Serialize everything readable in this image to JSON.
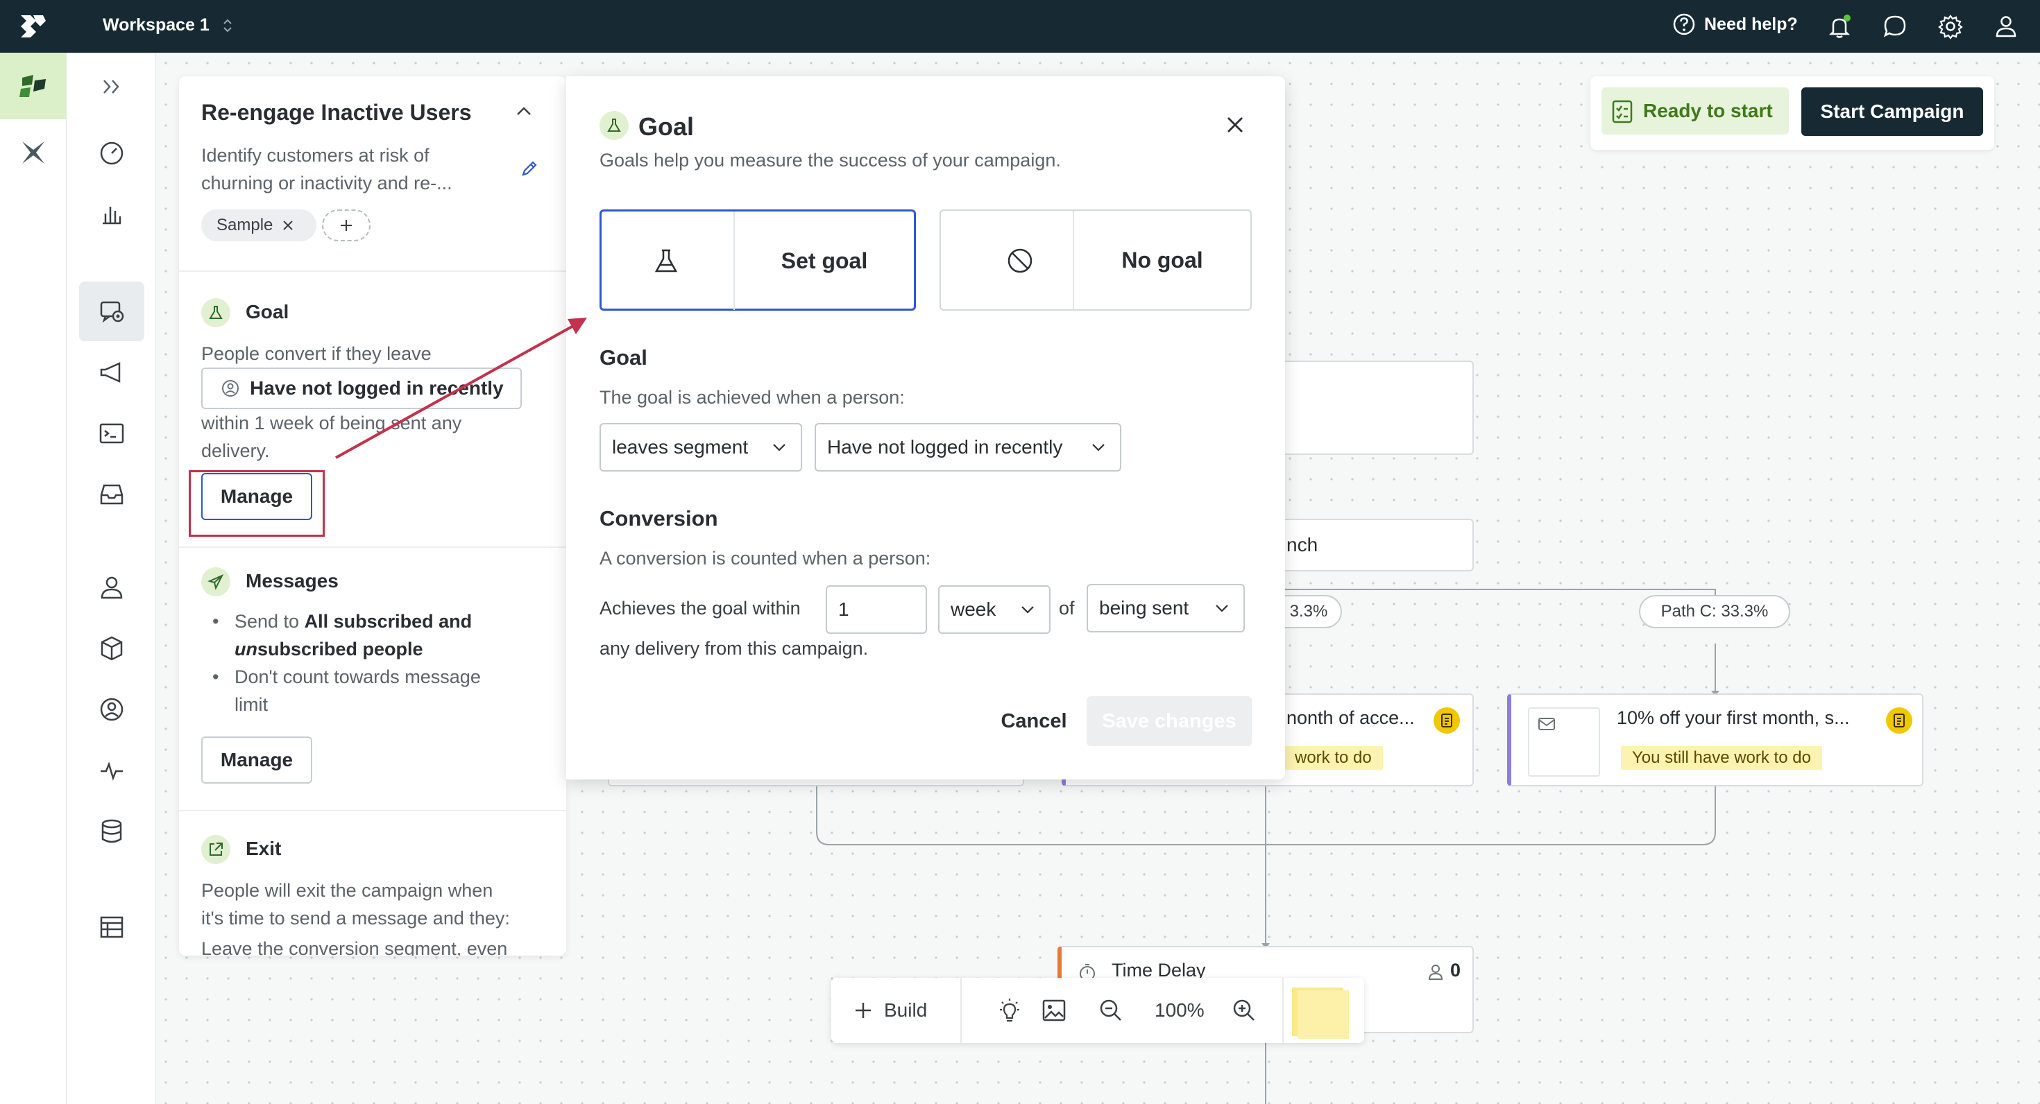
{
  "topbar": {
    "workspace": "Workspace 1",
    "need_help": "Need help?"
  },
  "sidebar_panel": {
    "title": "Re-engage Inactive Users",
    "description_line1": "Identify customers at risk of",
    "description_line2": "churning or inactivity and re-...",
    "tag": "Sample",
    "goal": {
      "heading": "Goal",
      "line1": "People convert if they leave",
      "segment": "Have not logged in recently",
      "line2": "within 1 week of being sent any",
      "line3": "delivery.",
      "manage": "Manage"
    },
    "messages": {
      "heading": "Messages",
      "bullet1_prefix": "Send to ",
      "bullet1_bold": "All subscribed and",
      "bullet1_italic": "un",
      "bullet1_bold2": "subscribed people",
      "bullet2_line1": "Don't count towards message",
      "bullet2_line2": "limit",
      "manage": "Manage"
    },
    "exit": {
      "heading": "Exit",
      "line1": "People will exit the campaign when",
      "line2": "it's time to send a message and they:",
      "line3": "Leave the conversion segment, even"
    }
  },
  "modal": {
    "title": "Goal",
    "subtitle": "Goals help you measure the success of your campaign.",
    "set_goal": "Set goal",
    "no_goal": "No goal",
    "goal_heading": "Goal",
    "goal_text": "The goal is achieved when a person:",
    "condition_value": "leaves segment",
    "segment_value": "Have not logged in recently",
    "conversion_heading": "Conversion",
    "conversion_text": "A conversion is counted when a person:",
    "achieves_within": "Achieves the goal within",
    "amount_value": "1",
    "unit_value": "week",
    "of_label": "of",
    "event_value": "being sent",
    "any_delivery": "any delivery from this campaign.",
    "cancel": "Cancel",
    "save": "Save changes"
  },
  "canvas": {
    "ready": "Ready to start",
    "start": "Start Campaign",
    "branch_partial": "nch",
    "path_b_partial": "3.3%",
    "path_c": "Path C: 33.3%",
    "msg_b_partial": "nonth of acce...",
    "msg_b_badge": "work to do",
    "msg_c_title": "10% off your first month, s...",
    "msg_c_badge": "You still have work to do",
    "time_delay": "Time Delay",
    "time_delay_count": "0"
  },
  "toolbar": {
    "build": "Build",
    "zoom": "100%"
  },
  "colors": {
    "topbar": "#172a33",
    "accent_blue": "#2f55d4",
    "highlight_red": "#c4314b",
    "green_light": "#e2f0d2"
  }
}
